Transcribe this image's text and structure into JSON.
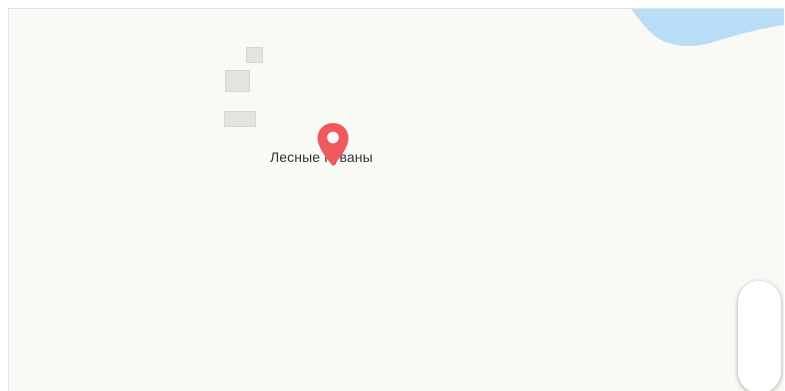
{
  "map": {
    "place_label": "Лесные Куваны",
    "marker_icon": "map-pin-icon",
    "colors": {
      "land": "#f9f9f6",
      "water": "#b9dcf7",
      "building": "#e3e3e0",
      "marker": "#ef5a5e"
    }
  },
  "controls": {
    "zoom_icon": "zoom-control"
  }
}
